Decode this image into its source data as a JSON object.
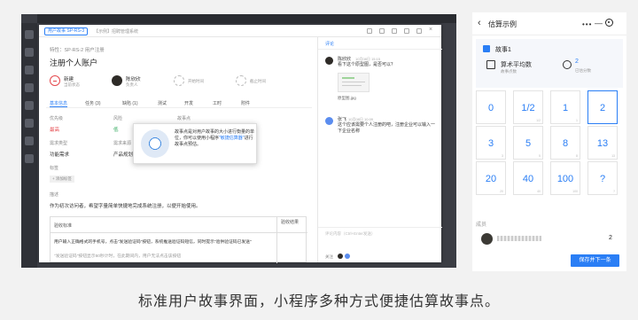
{
  "desktop": {
    "tag": "用户故事 SP-RS-3",
    "crumb": "【示例】招聘管理系统",
    "feature": "特性：SP-RS-2 用户注册",
    "title": "注册个人账户",
    "status": [
      {
        "value": "新建",
        "label": "当前状态"
      },
      {
        "value": "陈欣欣",
        "label": "负责人"
      },
      {
        "value": "",
        "label": "开始时间"
      },
      {
        "value": "",
        "label": "截止时间"
      }
    ],
    "tabs": [
      "基本信息",
      "任务 (3)",
      "缺陷 (1)",
      "测试",
      "开发",
      "工时",
      "附件"
    ],
    "fields": {
      "priority_label": "优先级",
      "priority_value": "最高",
      "risk_label": "风险",
      "risk_value": "低",
      "points_label": "故事点",
      "points_sub_label": "",
      "type_label": "需求类型",
      "type_value": "功能需求",
      "source_label": "需求来源",
      "source_value": "产品规划",
      "tag_label": "标签",
      "tag_add": "+ 添加标签",
      "desc_label": "描述",
      "desc_text": "作为初次访问者，希望字量简单快捷地完成系统注册，以便开始使用。"
    },
    "table": {
      "h1": "验收标准",
      "h2": "验收结果",
      "r1": "用户输入正确格式的手机号，点击\"发送验证码\"按钮，系统推送验证码短信，同时提示\"验供验证码已发送\"",
      "r2": "\"发送验证码\"按钮显示60秒计时，在此期间内，用户无法点击该按钮"
    },
    "popover": {
      "text": "故事点是对用户故事的大小进行衡量的单位，你可以使用小程序",
      "link": "\"敏捷估算器\"",
      "tail": "进行故事点预估。"
    },
    "comments": {
      "tab": "评论",
      "c1_name": "陈欣欣",
      "c1_time": "10月08日 15:15",
      "c1_text": "看下这个原型图，是否可以？",
      "c1_file": "原型图.jpg",
      "c2_name": "张飞",
      "c2_time": "10月08日 10:09",
      "c2_text": "这个应该需要个人注册的吧，注册企业可以输入一下企业名称",
      "input_placeholder": "评论内容（Ctrl+Enter发送）",
      "follow_label": "关注"
    }
  },
  "phone": {
    "back": "‹",
    "title": "估算示例",
    "menu": "•••",
    "dash": "—",
    "story_name": "故事1",
    "avg_label": "算术平均数",
    "avg_sub": "故事点数",
    "count_value": "2",
    "count_sub": "已估分数",
    "cards": [
      {
        "v": "0",
        "corner": ""
      },
      {
        "v": "1/2",
        "corner": "1/2"
      },
      {
        "v": "1",
        "corner": "1"
      },
      {
        "v": "2",
        "corner": ""
      },
      {
        "v": "3",
        "corner": "3"
      },
      {
        "v": "5",
        "corner": "5"
      },
      {
        "v": "8",
        "corner": "8"
      },
      {
        "v": "13",
        "corner": "13"
      },
      {
        "v": "20",
        "corner": "20"
      },
      {
        "v": "40",
        "corner": "40"
      },
      {
        "v": "100",
        "corner": "100"
      },
      {
        "v": "?",
        "corner": "?"
      }
    ],
    "members_label": "成员",
    "member_score": "2",
    "save_button": "保存并下一条"
  },
  "caption": "标准用户故事界面，小程序多种方式便捷估算故事点。",
  "colors": {
    "accent": "#2a7ef5",
    "dark_frame": "#3b3d44",
    "status_red": "#e5484d"
  }
}
